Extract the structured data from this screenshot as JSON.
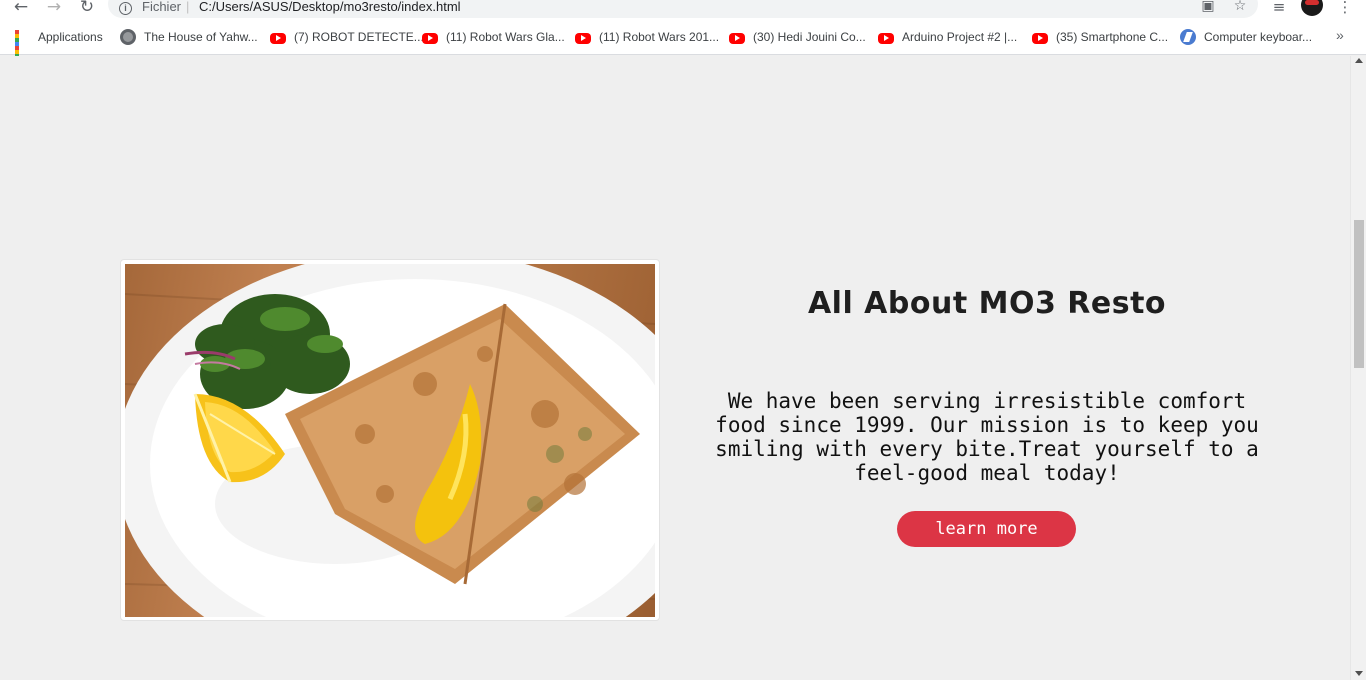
{
  "browser": {
    "scheme_label": "Fichier",
    "url": "C:/Users/ASUS/Desktop/mo3resto/index.html",
    "bookmarks": [
      {
        "label": "Applications",
        "icon": "apps-grid-icon"
      },
      {
        "label": "The House of Yahw...",
        "icon": "globe-icon"
      },
      {
        "label": "(7) ROBOT DETECTE...",
        "icon": "youtube-icon"
      },
      {
        "label": "(11) Robot Wars Gla...",
        "icon": "youtube-icon"
      },
      {
        "label": "(11) Robot Wars 201...",
        "icon": "youtube-icon"
      },
      {
        "label": "(30) Hedi Jouini Co...",
        "icon": "youtube-icon"
      },
      {
        "label": "Arduino Project #2 |...",
        "icon": "youtube-icon"
      },
      {
        "label": "(35) Smartphone C...",
        "icon": "youtube-icon"
      },
      {
        "label": "Computer keyboar...",
        "icon": "keyboard-site-icon"
      }
    ],
    "more_bookmarks": "»"
  },
  "about": {
    "heading": "All About MO3 Resto",
    "paragraph": "We have been serving irresistible comfort food since 1999. Our mission is to keep you smiling with every bite.Treat yourself to a feel-good meal today!",
    "button_label": "learn more",
    "image_alt": "Crispy folded crepe with egg yolk, greens and lemon on a white plate"
  },
  "colors": {
    "page_background": "#efefef",
    "button": "#dc3545",
    "heading": "#1f1f1f"
  }
}
